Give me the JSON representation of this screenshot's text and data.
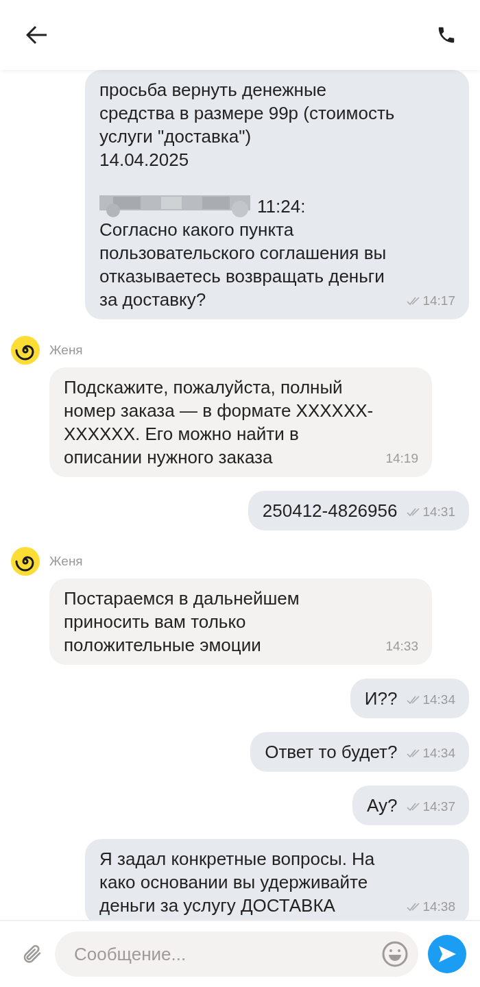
{
  "composer": {
    "placeholder": "Сообщение..."
  },
  "messages": [
    {
      "kind": "outgoing",
      "parts": [
        {
          "kind": "text",
          "text": "просьба вернуть денежные средства в размере 99р (стоимость услуги \"доставка\")\n14.04.2025"
        },
        {
          "kind": "redacted",
          "text": "11:24:"
        },
        {
          "kind": "text",
          "text": "Согласно какого пункта пользовательского соглашения  вы отказываетесь возвращать деньги за доставку?"
        }
      ],
      "time": "14:17",
      "read": true
    },
    {
      "kind": "incoming",
      "sender": "Женя",
      "parts": [
        {
          "kind": "text",
          "text": "Подскажите, пожалуйста, полный номер заказа — в формате XXXXXX-XXXXXX. Его можно найти в описании нужного заказа"
        }
      ],
      "time": "14:19"
    },
    {
      "kind": "outgoing",
      "parts": [
        {
          "kind": "text",
          "text": "250412-4826956"
        }
      ],
      "time": "14:31",
      "read": true
    },
    {
      "kind": "incoming",
      "sender": "Женя",
      "parts": [
        {
          "kind": "text",
          "text": "Постараемся в дальнейшем приносить вам только положительные эмоции"
        }
      ],
      "time": "14:33"
    },
    {
      "kind": "outgoing",
      "parts": [
        {
          "kind": "text",
          "text": "И??"
        }
      ],
      "time": "14:34",
      "read": true
    },
    {
      "kind": "outgoing",
      "parts": [
        {
          "kind": "text",
          "text": "Ответ то будет?"
        }
      ],
      "time": "14:34",
      "read": true
    },
    {
      "kind": "outgoing",
      "parts": [
        {
          "kind": "text",
          "text": "Ау?"
        }
      ],
      "time": "14:37",
      "read": true
    },
    {
      "kind": "outgoing",
      "parts": [
        {
          "kind": "text",
          "text": "Я задал конкретные вопросы. На како основании вы удерживайте деньги за услугу ДОСТАВКА"
        }
      ],
      "time": "14:38",
      "read": true
    }
  ]
}
